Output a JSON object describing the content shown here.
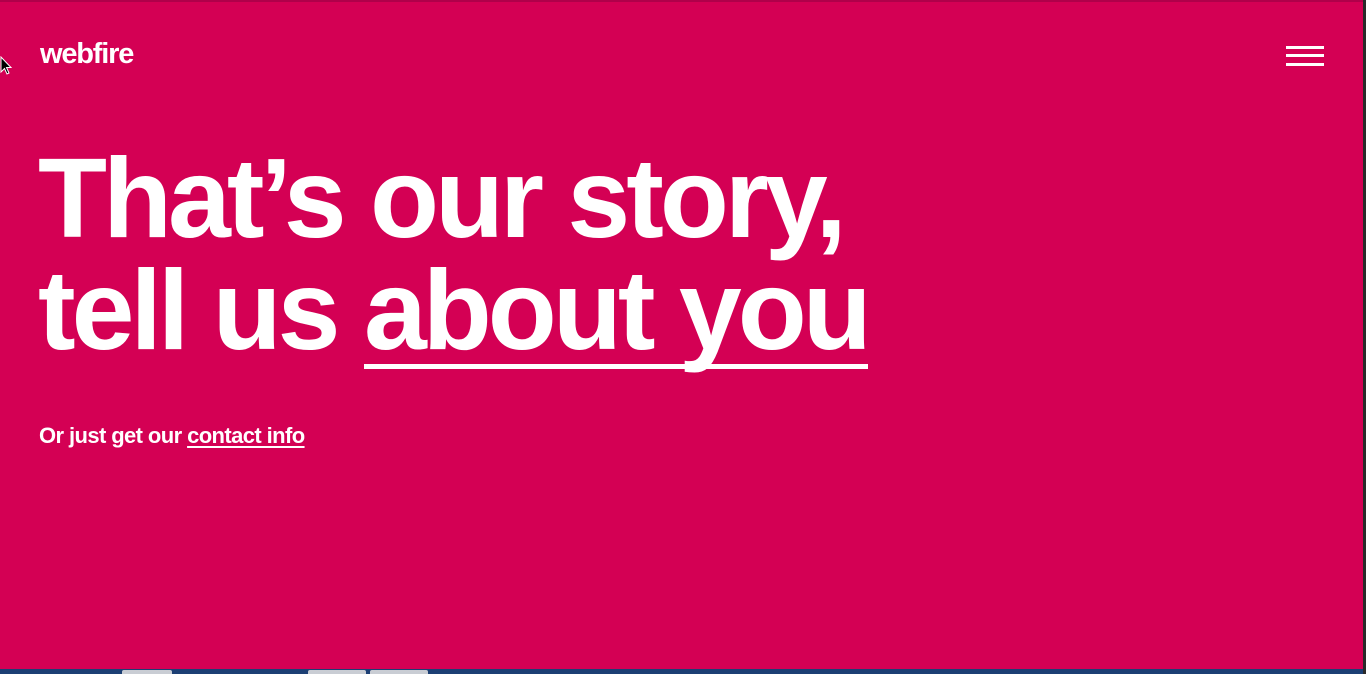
{
  "brand": {
    "logo_text": "webfire",
    "background_color": "#d40054",
    "text_color": "#ffffff"
  },
  "header": {
    "menu_icon": "hamburger-menu-icon"
  },
  "hero": {
    "line1": "That’s our story,",
    "line2_prefix": "tell us ",
    "line2_link": "about you",
    "sub_prefix": "Or just get our ",
    "sub_link": "contact info"
  },
  "icons": {
    "cursor": "mouse-pointer-icon"
  }
}
